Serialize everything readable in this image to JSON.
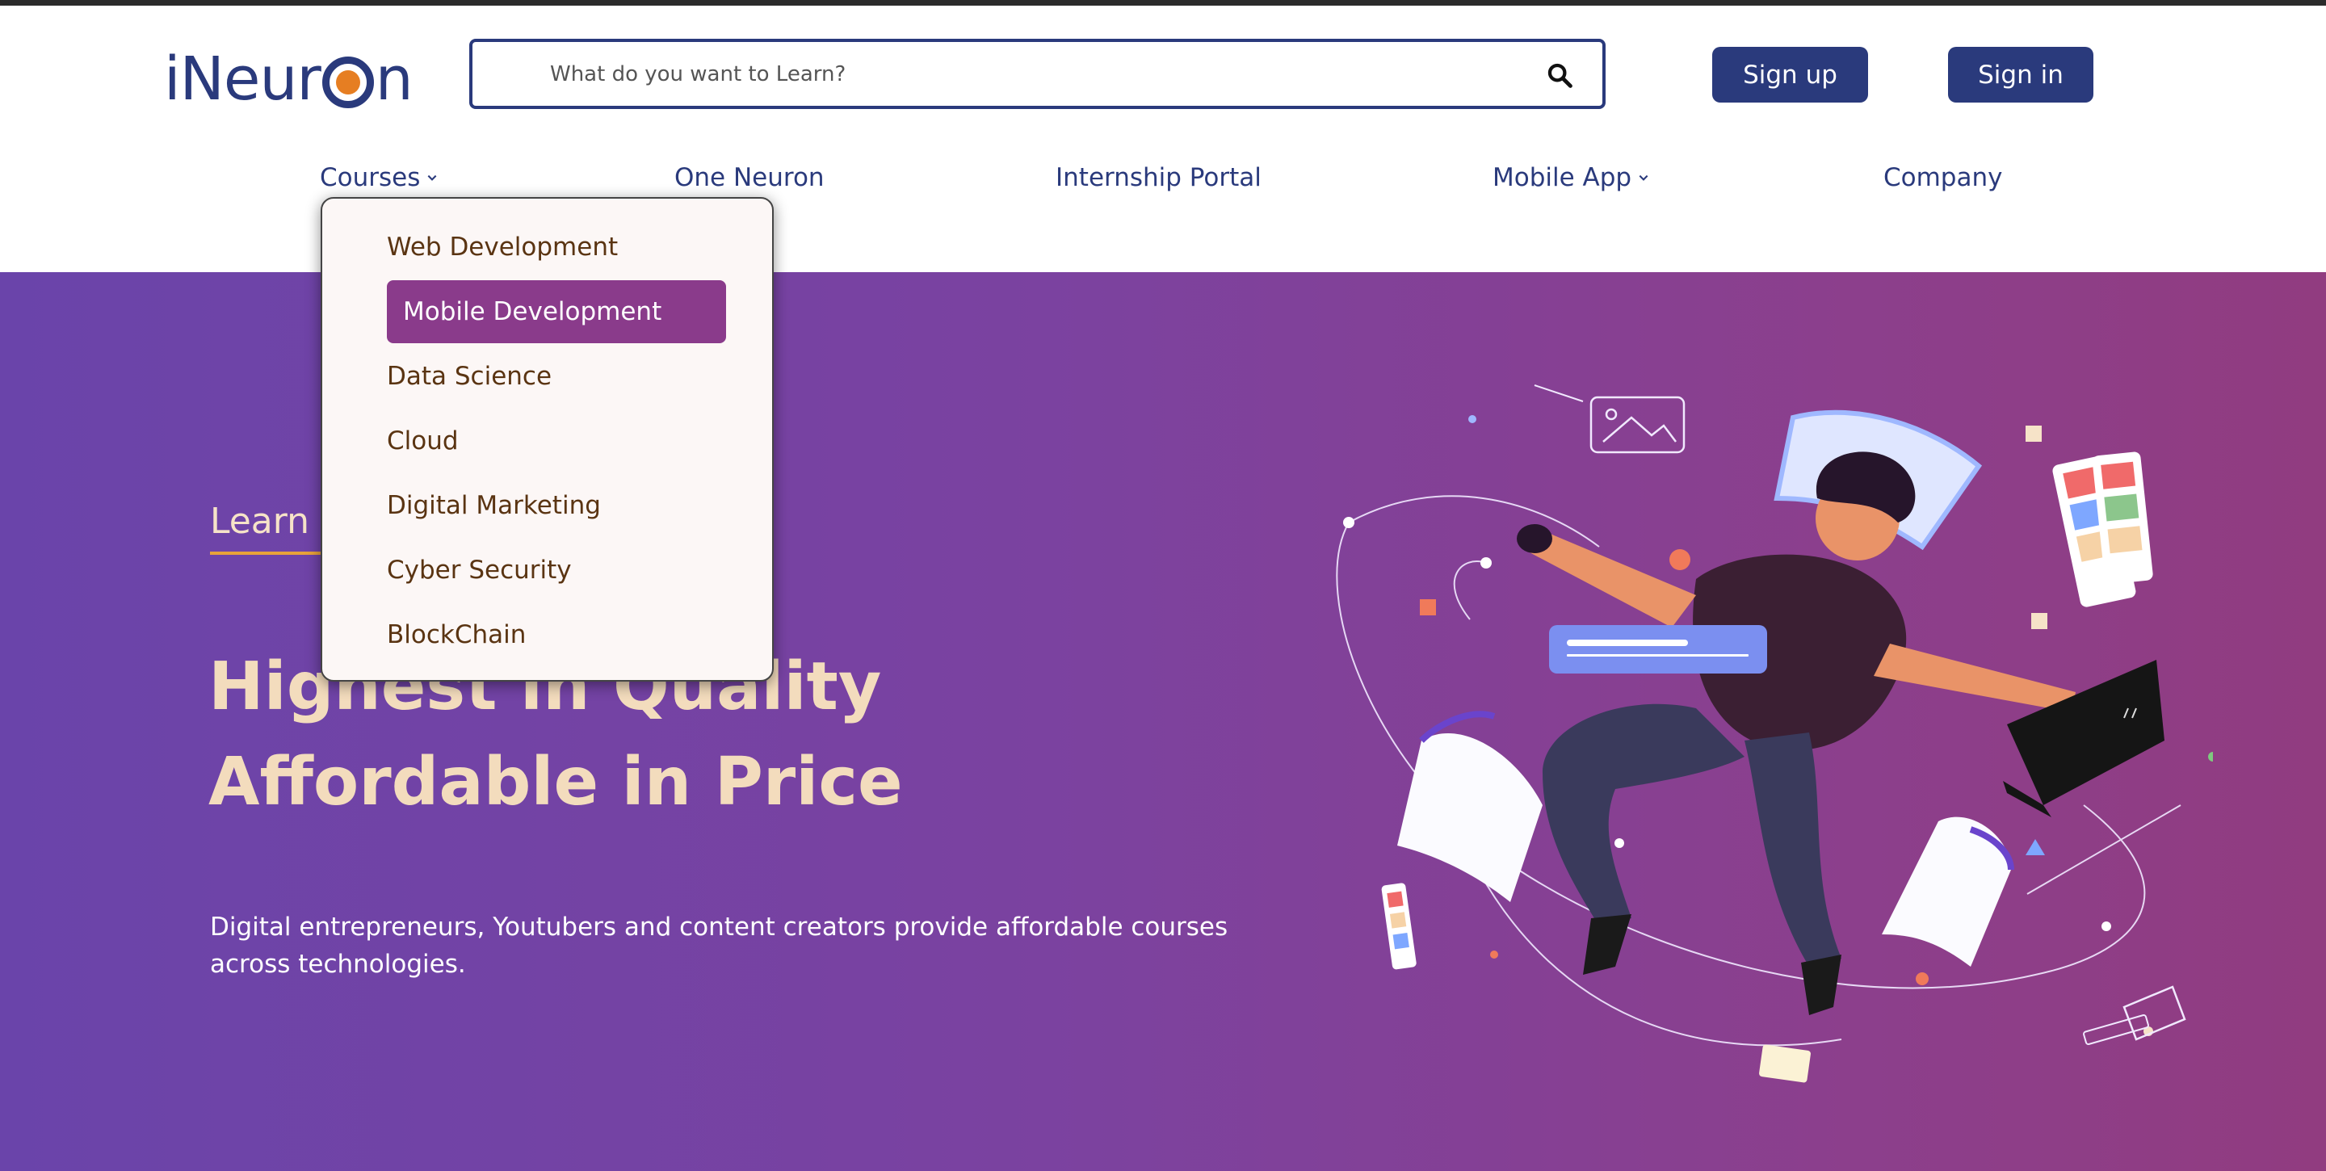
{
  "brand": {
    "logo_text_left": "iNeur",
    "logo_text_right": "n",
    "accent": "#e67e22",
    "primary": "#2a3a7c"
  },
  "search": {
    "placeholder": "What do you want to Learn?",
    "icon": "search-icon"
  },
  "auth": {
    "signup_label": "Sign up",
    "signin_label": "Sign in"
  },
  "nav": {
    "courses": "Courses",
    "one_neuron": "One Neuron",
    "internship": "Internship Portal",
    "mobile_app": "Mobile App",
    "company": "Company"
  },
  "dropdown": {
    "items": [
      {
        "label": "Web Development"
      },
      {
        "label": "Mobile Development"
      },
      {
        "label": "Data Science"
      },
      {
        "label": "Cloud"
      },
      {
        "label": "Digital Marketing"
      },
      {
        "label": "Cyber Security"
      },
      {
        "label": "BlockChain"
      }
    ],
    "active_label": "Mobile Development",
    "active_color": "#8a3b8b"
  },
  "hero": {
    "learn_text": "Learn t",
    "headline_line1": "Highest in Quality",
    "headline_line2": "Affordable in Price",
    "description": "Digital entrepreneurs, Youtubers and content creators provide affordable courses across technologies.",
    "gradient_start": "#6a44aa",
    "gradient_end": "#913c80"
  }
}
